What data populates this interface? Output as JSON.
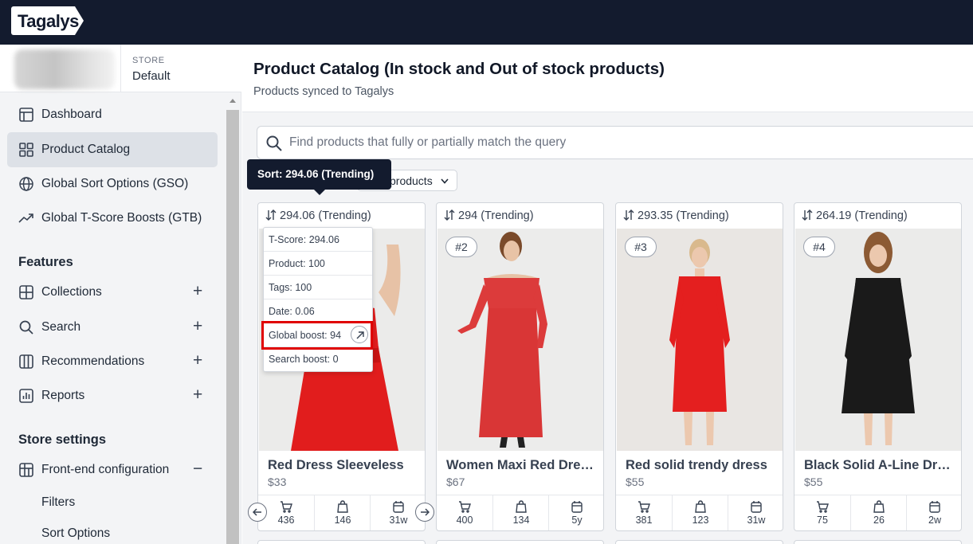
{
  "app": {
    "logo": "Tagalys"
  },
  "store": {
    "label": "STORE",
    "value": "Default"
  },
  "sidebar": {
    "items": [
      {
        "label": "Dashboard",
        "icon": "dashboard-icon"
      },
      {
        "label": "Product Catalog",
        "icon": "grid-icon",
        "active": true
      },
      {
        "label": "Global Sort Options (GSO)",
        "icon": "globe-icon"
      },
      {
        "label": "Global T-Score Boosts (GTB)",
        "icon": "trending-up-icon"
      }
    ],
    "features_title": "Features",
    "features": [
      {
        "label": "Collections",
        "icon": "collections-icon",
        "expand": "+"
      },
      {
        "label": "Search",
        "icon": "search-icon",
        "expand": "+"
      },
      {
        "label": "Recommendations",
        "icon": "columns-icon",
        "expand": "+"
      },
      {
        "label": "Reports",
        "icon": "reports-icon",
        "expand": "+"
      }
    ],
    "store_settings_title": "Store settings",
    "frontend": {
      "label": "Front-end configuration",
      "icon": "frontend-icon",
      "expand": "−"
    },
    "subitems": [
      "Filters",
      "Sort Options"
    ]
  },
  "page": {
    "title": "Product Catalog (In stock and Out of stock products)",
    "subtitle": "Products synced to Tagalys"
  },
  "search": {
    "placeholder": "Find products that fully or partially match the query"
  },
  "filter": {
    "label": "products"
  },
  "tooltip": {
    "text": "Sort: 294.06 (Trending)"
  },
  "products": [
    {
      "sort": "294.06 (Trending)",
      "rank": "",
      "name": "Red Dress Sleeveless",
      "price": "$33",
      "stats": [
        "436",
        "146",
        "31w"
      ]
    },
    {
      "sort": "294 (Trending)",
      "rank": "#2",
      "name": "Women Maxi Red Dres...",
      "price": "$67",
      "stats": [
        "400",
        "134",
        "5y"
      ]
    },
    {
      "sort": "293.35 (Trending)",
      "rank": "#3",
      "name": "Red solid trendy dress",
      "price": "$55",
      "stats": [
        "381",
        "123",
        "31w"
      ]
    },
    {
      "sort": "264.19 (Trending)",
      "rank": "#4",
      "name": "Black Solid A-Line Dress",
      "price": "$55",
      "stats": [
        "75",
        "26",
        "2w"
      ]
    }
  ],
  "score_breakdown": [
    "T-Score: 294.06",
    "Product: 100",
    "Tags: 100",
    "Date: 0.06",
    "Global boost: 94",
    "Search boost: 0"
  ],
  "colors": {
    "topbar": "#131b2e",
    "highlight": "#e00000",
    "dress_red": "#dc2626",
    "dress_black": "#1a1a1a"
  }
}
